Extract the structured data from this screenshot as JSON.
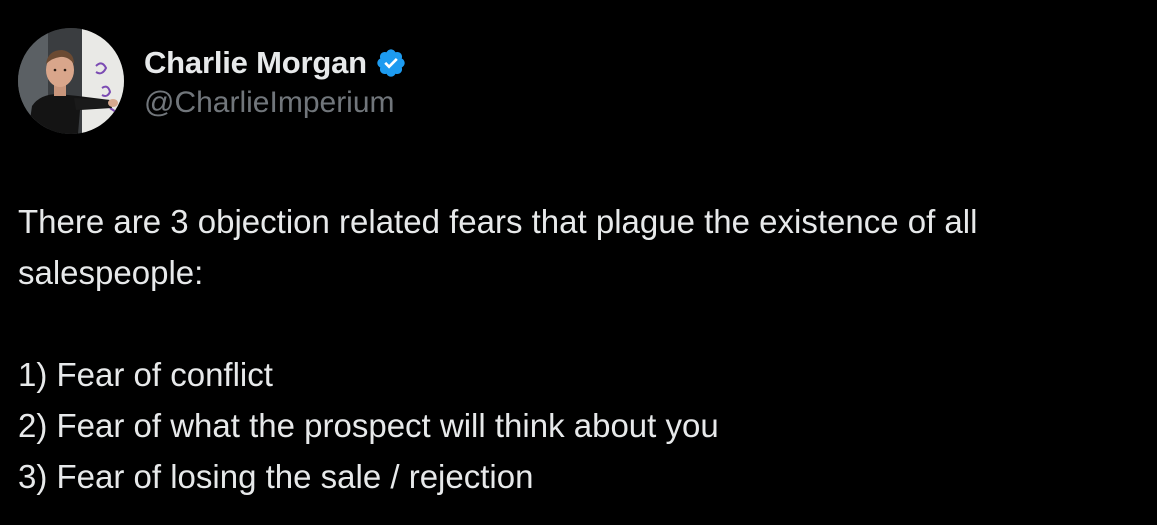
{
  "author": {
    "display_name": "Charlie Morgan",
    "handle": "@CharlieImperium",
    "verified": true,
    "verified_color": "#1d9bf0",
    "avatar_icon": "profile-photo"
  },
  "tweet": {
    "intro_line1": "There are 3 objection related fears that plague the existence of all",
    "intro_line2": "salespeople:",
    "items": [
      "1) Fear of conflict",
      "2) Fear of what the prospect will think about you",
      "3) Fear of losing the sale / rejection"
    ]
  },
  "colors": {
    "background": "#000000",
    "primary_text": "#e7e9ea",
    "secondary_text": "#71767b"
  }
}
